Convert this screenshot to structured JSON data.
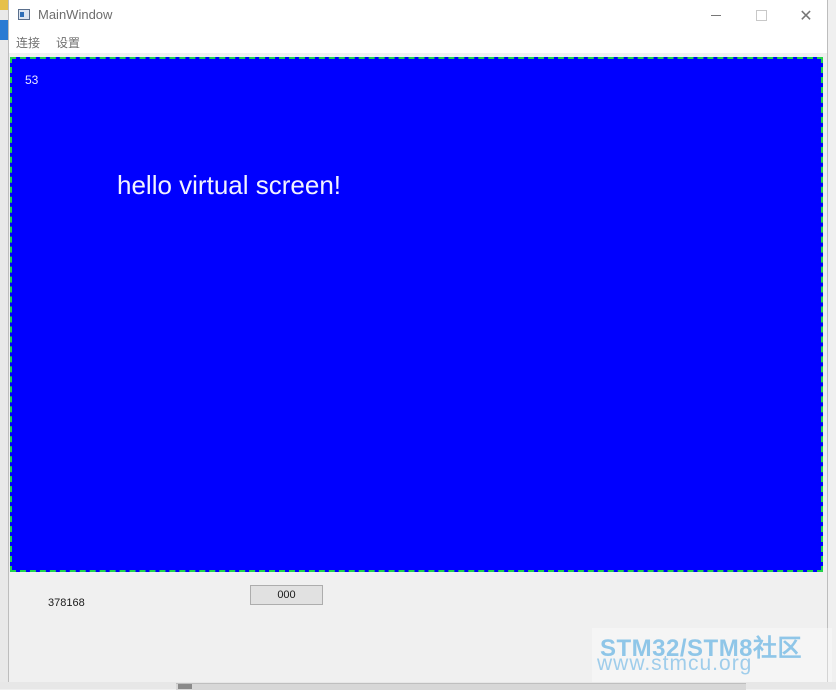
{
  "window": {
    "title": "MainWindow"
  },
  "menu": {
    "items": [
      "连接",
      "设置"
    ]
  },
  "screen": {
    "counter": "53",
    "message": "hello virtual screen!",
    "background_color": "#0000ff",
    "border_color": "#22d24a"
  },
  "status": {
    "value": "378168",
    "button_label": "000"
  },
  "watermark": {
    "line1": "STM32/STM8社区",
    "line2": "www.stmcu.org"
  }
}
